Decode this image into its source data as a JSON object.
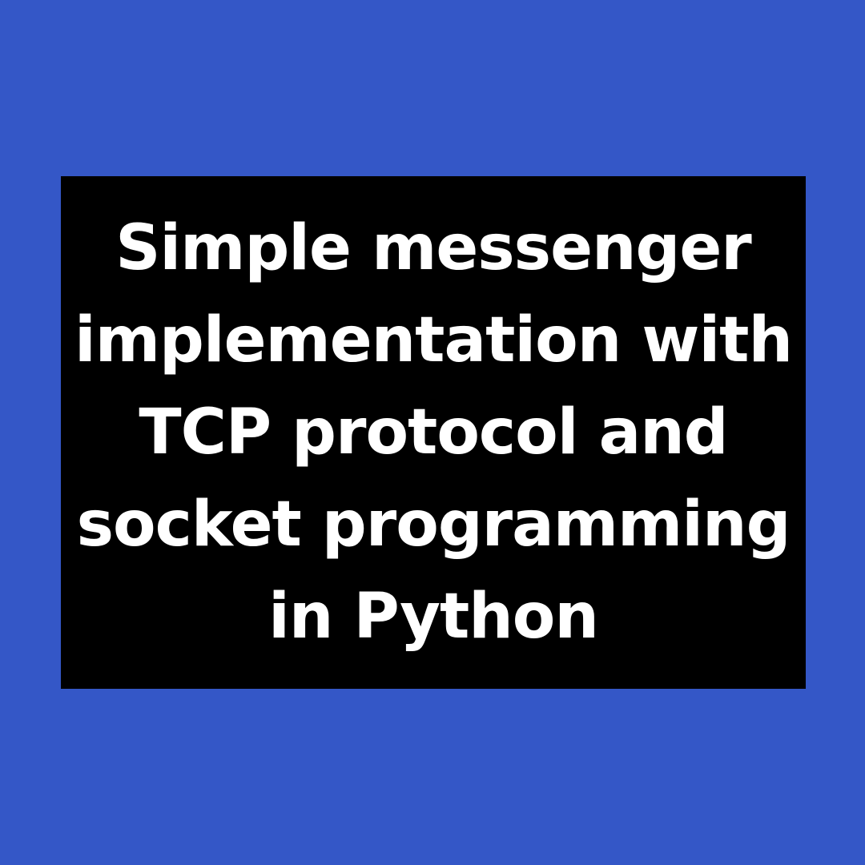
{
  "colors": {
    "background": "#3457c7",
    "card": "#000000",
    "text": "#ffffff"
  },
  "title": {
    "lines": [
      "Simple messenger",
      "implementation with",
      "TCP protocol and",
      "socket programming",
      "in Python"
    ]
  }
}
